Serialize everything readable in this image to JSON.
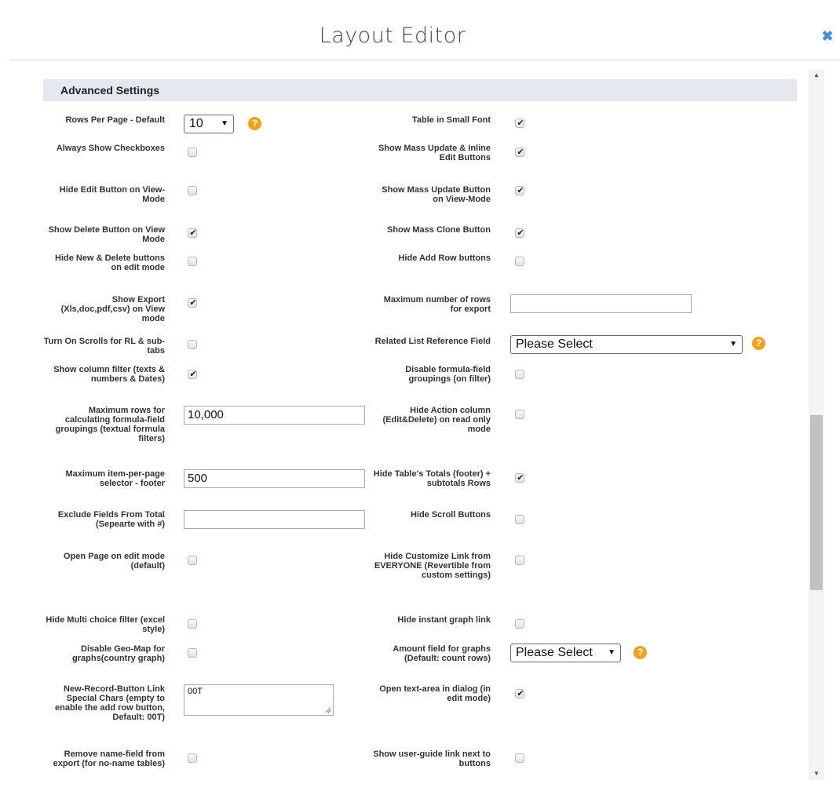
{
  "dialog": {
    "title": "Layout Editor",
    "close_icon": "close-icon"
  },
  "section": {
    "title": "Advanced Settings"
  },
  "left": {
    "rows_per_page": {
      "label": "Rows Per Page - Default",
      "value": "10"
    },
    "always_show_checkboxes": {
      "label": "Always Show Checkboxes",
      "checked": false
    },
    "hide_edit_button": {
      "label": "Hide Edit Button on View-Mode",
      "checked": false
    },
    "show_delete_button": {
      "label": "Show Delete Button on View Mode",
      "checked": true
    },
    "hide_new_delete": {
      "label": "Hide New & Delete buttons on edit mode",
      "checked": false
    },
    "show_export": {
      "label": "Show Export (Xls,doc,pdf,csv) on View mode",
      "checked": true
    },
    "turn_on_scrolls": {
      "label": "Turn On Scrolls for RL & sub-tabs",
      "checked": false
    },
    "show_column_filter": {
      "label": "Show column filter (texts & numbers & Dates)",
      "checked": true
    },
    "max_rows_formula": {
      "label": "Maximum rows for calculating formula-field groupings (textual formula filters)",
      "value": "10,000"
    },
    "max_item_per_page": {
      "label": "Maximum item-per-page selector - footer",
      "value": "500"
    },
    "exclude_fields": {
      "label": "Exclude Fields From Total (Sepearte with #)",
      "value": ""
    },
    "open_page_edit": {
      "label": "Open Page on edit mode (default)",
      "checked": false
    },
    "hide_multi_choice": {
      "label": "Hide Multi choice filter (excel style)",
      "checked": false
    },
    "disable_geo_map": {
      "label": "Disable Geo-Map for graphs(country graph)",
      "checked": false
    },
    "new_record_chars": {
      "label": "New-Record-Button Link Special Chars (empty to enable the add row button, Default: 00T)",
      "value": "00T"
    },
    "remove_name_field": {
      "label": "Remove name-field from export (for no-name tables)",
      "checked": false
    }
  },
  "right": {
    "table_small_font": {
      "label": "Table in Small Font",
      "checked": true
    },
    "show_mass_update_inline": {
      "label": "Show Mass Update & Inline Edit Buttons",
      "checked": true
    },
    "show_mass_update_view": {
      "label": "Show Mass Update Button on View-Mode",
      "checked": true
    },
    "show_mass_clone": {
      "label": "Show Mass Clone Button",
      "checked": true
    },
    "hide_add_row": {
      "label": "Hide Add Row buttons",
      "checked": false
    },
    "max_rows_export": {
      "label": "Maximum number of rows for export",
      "value": ""
    },
    "related_list_ref": {
      "label": "Related List Reference Field",
      "value": "Please Select"
    },
    "disable_formula_groupings": {
      "label": "Disable formula-field groupings (on filter)",
      "checked": false
    },
    "hide_action_column": {
      "label": "Hide Action column (Edit&Delete) on read only mode",
      "checked": false
    },
    "hide_totals": {
      "label": "Hide Table's Totals (footer) + subtotals Rows",
      "checked": true
    },
    "hide_scroll_buttons": {
      "label": "Hide Scroll Buttons",
      "checked": false
    },
    "hide_customize_link": {
      "label": "Hide Customize Link from EVERYONE (Revertible from custom settings)",
      "checked": false
    },
    "hide_instant_graph": {
      "label": "Hide instant graph link",
      "checked": false
    },
    "amount_field_graphs": {
      "label": "Amount field for graphs (Default: count rows)",
      "value": "Please Select"
    },
    "open_textarea_dialog": {
      "label": "Open text-area in dialog (in edit mode)",
      "checked": true
    },
    "show_user_guide": {
      "label": "Show user-guide link next to buttons",
      "checked": false
    }
  },
  "help_glyph": "?",
  "check_glyph": "✔",
  "scrollbar": {
    "up": "▲",
    "down": "▼"
  }
}
